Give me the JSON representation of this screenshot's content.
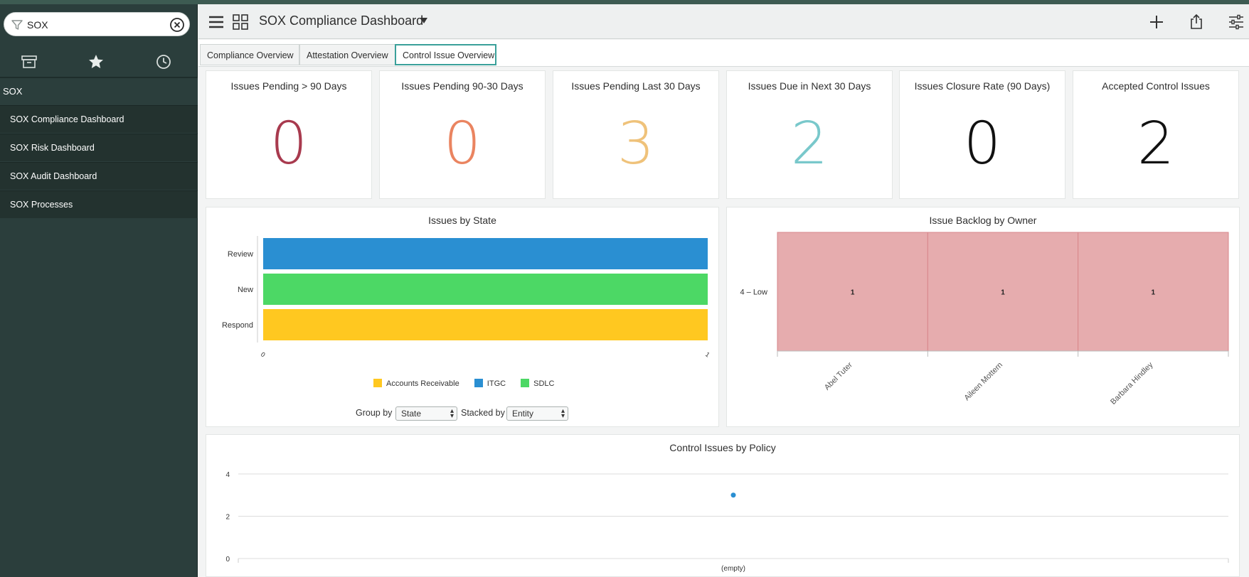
{
  "sidebar": {
    "filter_value": "SOX",
    "section_label": "SOX",
    "items": [
      {
        "label": "SOX Compliance Dashboard"
      },
      {
        "label": "SOX Risk Dashboard"
      },
      {
        "label": "SOX Audit Dashboard"
      },
      {
        "label": "SOX Processes"
      }
    ],
    "tab_icons": [
      "archive-icon",
      "star-icon",
      "clock-icon"
    ]
  },
  "header": {
    "title": "SOX Compliance Dashboard",
    "icons": [
      "menu-icon",
      "grid-icon",
      "caret-down-icon",
      "plus-icon",
      "share-icon",
      "sliders-icon"
    ]
  },
  "tabs": [
    {
      "label": "Compliance Overview"
    },
    {
      "label": "Attestation Overview"
    },
    {
      "label": "Control Issue Overview",
      "active": true
    }
  ],
  "stats": [
    {
      "title": "Issues Pending > 90 Days",
      "value": "0",
      "color": "#a83a4e"
    },
    {
      "title": "Issues Pending 90-30 Days",
      "value": "0",
      "color": "#ea8460"
    },
    {
      "title": "Issues Pending Last 30 Days",
      "value": "3",
      "color": "#efc27a"
    },
    {
      "title": "Issues Due in Next 30 Days",
      "value": "2",
      "color": "#79c8cb"
    },
    {
      "title": "Issues Closure Rate (90 Days)",
      "value": "0",
      "color": "#111111"
    },
    {
      "title": "Accepted Control Issues",
      "value": "2",
      "color": "#111111"
    }
  ],
  "chart_data": [
    {
      "type": "bar",
      "orientation": "horizontal",
      "stacked": true,
      "title": "Issues by State",
      "categories": [
        "Review",
        "New",
        "Respond"
      ],
      "series": [
        {
          "name": "Accounts Receivable",
          "color": "#ffc820",
          "values": [
            0,
            0,
            1
          ]
        },
        {
          "name": "ITGC",
          "color": "#2a8fd2",
          "values": [
            1,
            0,
            0
          ]
        },
        {
          "name": "SDLC",
          "color": "#4cd865",
          "values": [
            0,
            1,
            0
          ]
        }
      ],
      "xlim": [
        0,
        1
      ],
      "x_ticks": [
        "0",
        "1"
      ],
      "legend": "bottom",
      "controls": {
        "group_by_label": "Group by",
        "group_by_value": "State",
        "stacked_by_label": "Stacked by",
        "stacked_by_value": "Entity"
      }
    },
    {
      "type": "heatmap",
      "title": "Issue Backlog by Owner",
      "rows": [
        "4 – Low"
      ],
      "columns": [
        "Abel Tuter",
        "Aileen Mottern",
        "Barbara Hindley"
      ],
      "values": [
        [
          1,
          1,
          1
        ]
      ],
      "color": "#e6acae"
    },
    {
      "type": "scatter",
      "title": "Control Issues by Policy",
      "categories": [
        "(empty)"
      ],
      "values": [
        3
      ],
      "y_ticks": [
        "0",
        "2",
        "4"
      ],
      "ylim": [
        0,
        4
      ],
      "grid": true,
      "color": "#2a8fd2"
    }
  ]
}
